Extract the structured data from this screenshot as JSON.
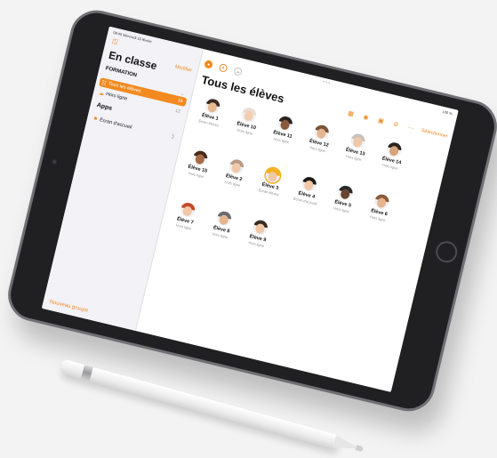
{
  "status": {
    "time": "09:45",
    "date": "Mercredi 15 février",
    "battery": "100 %"
  },
  "sidebar": {
    "title": "En classe",
    "edit_label": "Modifier",
    "toggle_icon": "sidebar-icon",
    "section_formation": "FORMATION",
    "section_apps": "Apps",
    "items": [
      {
        "label": "Tous les élèves",
        "count": "16",
        "icon": "people-icon",
        "active": true
      },
      {
        "label": "Hors ligne",
        "count": "12",
        "icon": "cloud-offline-icon",
        "active": false
      },
      {
        "label": "Écran d'accueil",
        "count": "2",
        "icon": "home-screen-icon",
        "active": false
      }
    ],
    "new_group_label": "Nouveau groupe"
  },
  "main": {
    "title": "Tous les élèves",
    "select_label": "Sélectionner",
    "top_icons": [
      "layers-icon",
      "compass-icon",
      "cloud-icon"
    ],
    "toolbar_icons": [
      "screen-grid-icon",
      "eye-icon",
      "lock-icon",
      "mute-icon",
      "more-icon"
    ],
    "students": [
      {
        "name": "Élève 1",
        "status": "Écran élèves"
      },
      {
        "name": "Élève 10",
        "status": "Hors ligne"
      },
      {
        "name": "Élève 11",
        "status": "Hors ligne"
      },
      {
        "name": "Élève 12",
        "status": "Hors ligne"
      },
      {
        "name": "Élève 13",
        "status": "Hors ligne"
      },
      {
        "name": "Élève 14",
        "status": "Hors ligne"
      },
      {
        "name": "Élève 15",
        "status": "Hors ligne"
      },
      {
        "name": "Élève 2",
        "status": "Hors ligne"
      },
      {
        "name": "Élève 3",
        "status": "Écran élèves"
      },
      {
        "name": "Élève 4",
        "status": "Écran d'accueil"
      },
      {
        "name": "Élève 5",
        "status": "Hors ligne"
      },
      {
        "name": "Élève 6",
        "status": "Hors ligne"
      },
      {
        "name": "Élève 7",
        "status": "Hors ligne"
      },
      {
        "name": "Élève 8",
        "status": "Hors ligne"
      },
      {
        "name": "Élève 9",
        "status": "Hors ligne"
      }
    ]
  },
  "colors": {
    "accent": "#f28a20",
    "ipad_body": "#202022",
    "background": "#f3f3f4"
  }
}
